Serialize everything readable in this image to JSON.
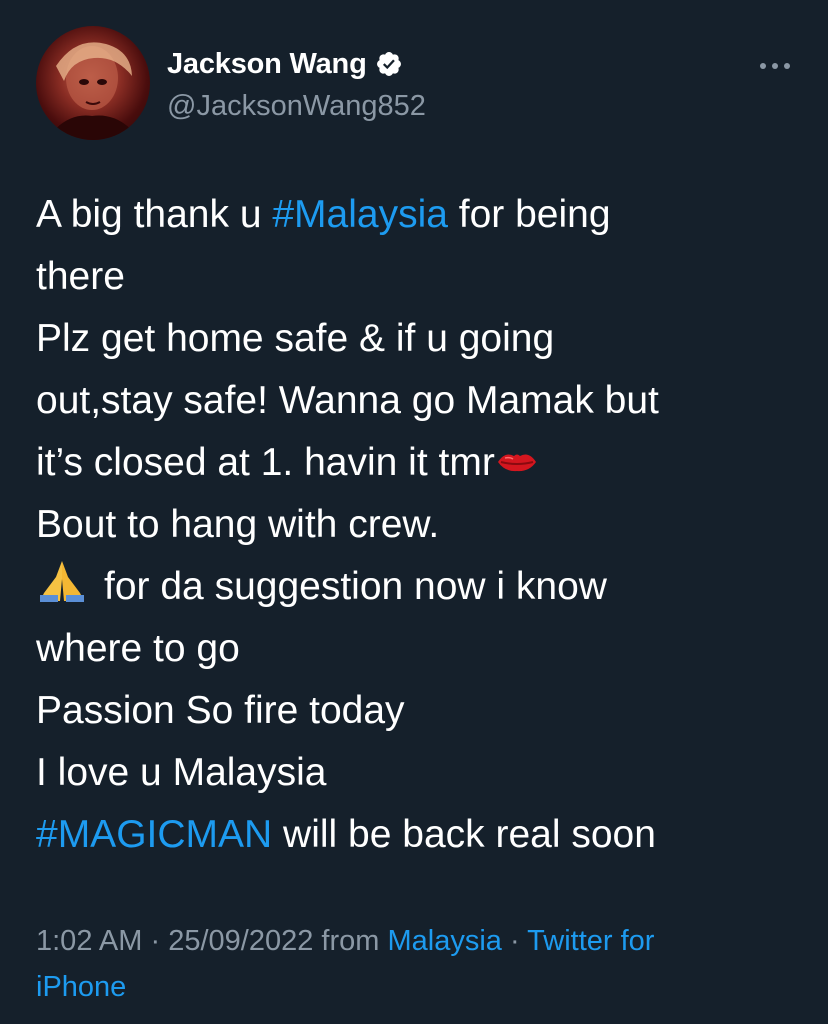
{
  "author": {
    "display_name": "Jackson Wang",
    "handle": "@JacksonWang852",
    "verified": true,
    "avatar_icon": "profile-photo"
  },
  "more_icon": "ellipsis-icon",
  "tweet": {
    "lines": [
      [
        "A big thank u ",
        "#Malaysia",
        " for being"
      ],
      [
        "there"
      ],
      [
        "Plz get home safe & if u going"
      ],
      [
        "out,stay safe! Wanna go Mamak but"
      ],
      [
        "it’s closed at 1. havin it tmr"
      ],
      [
        "Bout to hang with crew."
      ],
      [
        "for da suggestion now i know"
      ],
      [
        "where to go"
      ],
      [
        "Passion So fire today"
      ],
      [
        "I love u Malaysia"
      ],
      [
        "#MAGICMAN",
        " will be back real soon"
      ]
    ],
    "hashtag_1": "#Malaysia",
    "hashtag_2": "#MAGICMAN",
    "emojis": [
      "kiss-mark-emoji",
      "folded-hands-emoji"
    ]
  },
  "meta": {
    "time": "1:02 AM",
    "sep1": " · ",
    "date": "25/09/2022",
    "from_text": " from ",
    "location": "Malaysia",
    "sep2": " · ",
    "source_line1": "Twitter for",
    "source_line2": "iPhone"
  },
  "colors": {
    "background": "#15202b",
    "text": "#ffffff",
    "secondary": "#8b98a5",
    "link": "#1d9bf0"
  }
}
